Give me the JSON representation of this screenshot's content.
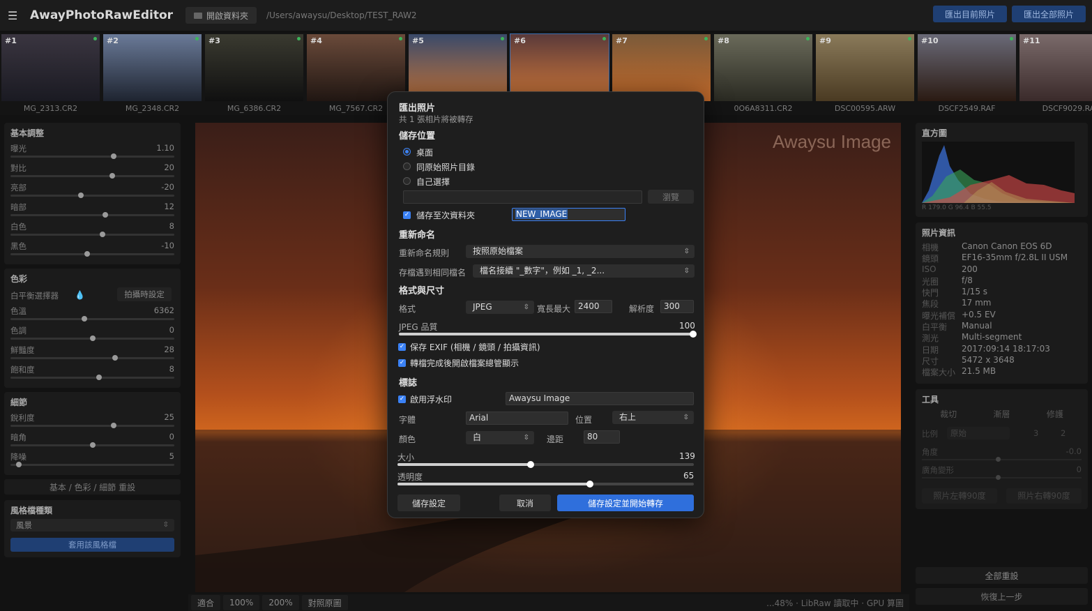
{
  "app": {
    "title": "AwayPhotoRawEditor",
    "open_folder": "開啟資料夾",
    "path": "/Users/awaysu/Desktop/TEST_RAW2",
    "export_current": "匯出目前照片",
    "export_all": "匯出全部照片"
  },
  "thumbnails": [
    {
      "num": "#1",
      "name": "MG_2313.CR2",
      "colors": [
        "#3a3540",
        "#1a1a22"
      ]
    },
    {
      "num": "#2",
      "name": "MG_2348.CR2",
      "colors": [
        "#6a7a98",
        "#1e2430"
      ]
    },
    {
      "num": "#3",
      "name": "MG_6386.CR2",
      "colors": [
        "#3a3a30",
        "#101010"
      ]
    },
    {
      "num": "#4",
      "name": "MG_7567.CR2",
      "colors": [
        "#6a4a3a",
        "#201612"
      ]
    },
    {
      "num": "#5",
      "name": "",
      "colors": [
        "#3a4a6a",
        "#c4743a"
      ]
    },
    {
      "num": "#6",
      "name": "",
      "colors": [
        "#5a3a3a",
        "#d47a3a"
      ]
    },
    {
      "num": "#7",
      "name": "",
      "colors": [
        "#7a5a3a",
        "#c46a2a"
      ]
    },
    {
      "num": "#8",
      "name": "0O6A8311.CR2",
      "colors": [
        "#6a6a5a",
        "#2a2a22"
      ]
    },
    {
      "num": "#9",
      "name": "DSC00595.ARW",
      "colors": [
        "#8a7a5a",
        "#4a3a22"
      ]
    },
    {
      "num": "#10",
      "name": "DSCF2549.RAF",
      "colors": [
        "#6a6a78",
        "#2a1a12"
      ]
    },
    {
      "num": "#11",
      "name": "DSCF9029.RA",
      "colors": [
        "#7a6a6a",
        "#3a2a2a"
      ]
    }
  ],
  "left": {
    "basic": {
      "title": "基本調整",
      "sliders": [
        {
          "label": "曝光",
          "value": "1.10",
          "pos": 0.63
        },
        {
          "label": "對比",
          "value": "20",
          "pos": 0.62
        },
        {
          "label": "亮部",
          "value": "-20",
          "pos": 0.43
        },
        {
          "label": "暗部",
          "value": "12",
          "pos": 0.58
        },
        {
          "label": "白色",
          "value": "8",
          "pos": 0.56
        },
        {
          "label": "黑色",
          "value": "-10",
          "pos": 0.47
        }
      ]
    },
    "color": {
      "title": "色彩",
      "wb_label": "白平衡選擇器",
      "shot_setting": "拍攝時設定",
      "sliders": [
        {
          "label": "色溫",
          "value": "6362",
          "pos": 0.45
        },
        {
          "label": "色調",
          "value": "0",
          "pos": 0.5
        },
        {
          "label": "鮮豔度",
          "value": "28",
          "pos": 0.64
        },
        {
          "label": "飽和度",
          "value": "8",
          "pos": 0.54
        }
      ]
    },
    "detail": {
      "title": "細節",
      "sliders": [
        {
          "label": "銳利度",
          "value": "25",
          "pos": 0.63
        },
        {
          "label": "暗角",
          "value": "0",
          "pos": 0.5
        },
        {
          "label": "降噪",
          "value": "5",
          "pos": 0.05
        }
      ]
    },
    "reset": "基本 / 色彩 / 細節 重設",
    "style": {
      "title": "風格檔種類",
      "selected": "風景",
      "apply": "套用該風格檔"
    }
  },
  "canvas": {
    "watermark": "Awaysu Image"
  },
  "bottom": {
    "fit": "適合",
    "z100": "100%",
    "z200": "200%",
    "compare": "對照原圖",
    "status": "...48% · LibRaw 讀取中 · GPU 算圖"
  },
  "right": {
    "histogram": {
      "title": "直方圖",
      "caption": "R 179.0   G 96.4   B 55.5"
    },
    "info": {
      "title": "照片資訊",
      "rows": [
        {
          "k": "相機",
          "v": "Canon Canon EOS 6D"
        },
        {
          "k": "鏡頭",
          "v": "EF16-35mm f/2.8L II USM"
        },
        {
          "k": "ISO",
          "v": "200"
        },
        {
          "k": "光圈",
          "v": "f/8"
        },
        {
          "k": "快門",
          "v": "1/15 s"
        },
        {
          "k": "焦段",
          "v": "17 mm"
        },
        {
          "k": "曝光補償",
          "v": "+0.5 EV"
        },
        {
          "k": "白平衡",
          "v": "Manual"
        },
        {
          "k": "測光",
          "v": "Multi-segment"
        },
        {
          "k": "日期",
          "v": "2017:09:14 18:17:03"
        },
        {
          "k": "尺寸",
          "v": "5472 x 3648"
        },
        {
          "k": "檔案大小",
          "v": "21.5 MB"
        }
      ]
    },
    "tools": {
      "title": "工具",
      "tabs": [
        "裁切",
        "漸層",
        "修護"
      ],
      "ratio_label": "比例",
      "ratio_value": "原始",
      "ratio_w": "3",
      "ratio_h": "2",
      "angle_label": "角度",
      "angle_value": "-0.0",
      "distort_label": "廣角變形",
      "distort_value": "0",
      "rotate_left": "照片左轉90度",
      "rotate_right": "照片右轉90度"
    },
    "reset_all": "全部重設",
    "undo": "恢復上一步"
  },
  "dialog": {
    "title": "匯出照片",
    "subtitle": "共 1 張相片將被轉存",
    "save_location": "儲存位置",
    "opt_desktop": "桌面",
    "opt_same": "同原始照片目錄",
    "opt_custom": "自己選擇",
    "browse": "瀏覽",
    "subfolder_label": "儲存至次資料夾",
    "subfolder_value": "NEW_IMAGE",
    "rename_title": "重新命名",
    "rename_rule_label": "重新命名規則",
    "rename_rule_value": "按照原始檔案",
    "dup_label": "存檔遇到相同檔名",
    "dup_value": "檔名接續 \"_數字\"，例如 _1, _2...",
    "format_title": "格式與尺寸",
    "format_label": "格式",
    "format_value": "JPEG",
    "long_edge_label": "寬長最大",
    "long_edge_value": "2400",
    "resolution_label": "解析度",
    "resolution_value": "300",
    "quality_label": "JPEG 品質",
    "quality_value": "100",
    "quality_fraction": 1.0,
    "keep_exif": "保存 EXIF (相機 / 鏡頭 / 拍攝資訊)",
    "open_finder": "轉檔完成後開啟檔案總管顯示",
    "mark_title": "標誌",
    "enable_watermark": "啟用浮水印",
    "watermark_text": "Awaysu Image",
    "font_label": "字體",
    "font_value": "Arial",
    "position_label": "位置",
    "position_value": "右上",
    "color_label": "顏色",
    "color_value": "白",
    "margin_label": "邊距",
    "margin_value": "80",
    "size_label": "大小",
    "size_value": "139",
    "size_fraction": 0.45,
    "opacity_label": "透明度",
    "opacity_value": "65",
    "opacity_fraction": 0.65,
    "save_settings": "儲存設定",
    "cancel": "取消",
    "save_and_start": "儲存設定並開始轉存"
  },
  "colors": {
    "accent": "#3b82f6",
    "primary_button": "#2f6fdc",
    "export_button": "#1f3f73"
  }
}
